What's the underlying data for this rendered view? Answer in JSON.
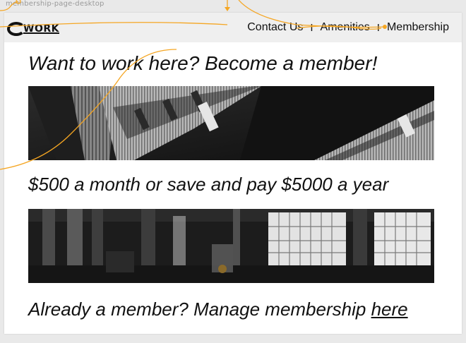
{
  "canvas": {
    "artboard_label": "membership-page-desktop"
  },
  "navbar": {
    "logo_text": "WORK",
    "links": [
      {
        "label": "Contact Us"
      },
      {
        "label": "Amenities"
      },
      {
        "label": "Membership"
      }
    ],
    "separator": "I"
  },
  "main": {
    "headline": "Want to work here? Become a member!",
    "pricing": "$500 a month or save and pay $5000 a year",
    "footer_prefix": "Already a member? Manage membership ",
    "footer_link": "here"
  },
  "images": {
    "building_photo": "building-facade-photo",
    "office_photo": "office-interior-photo"
  },
  "colors": {
    "prototype_link": "#f5a623",
    "navbar_bg": "#efefef",
    "text": "#111111"
  }
}
